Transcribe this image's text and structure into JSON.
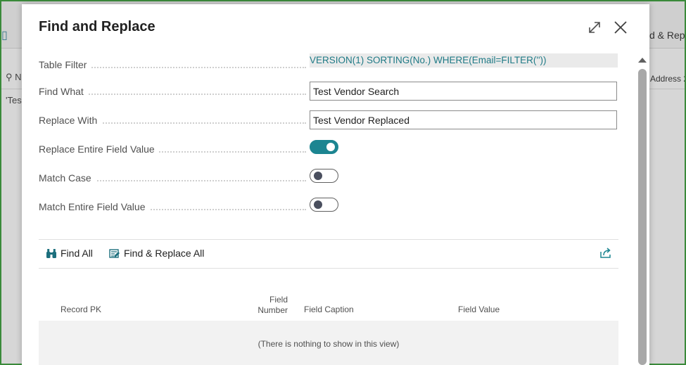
{
  "background": {
    "left_n": "N",
    "left_tes": "'Tes",
    "right_action": "d & Rep",
    "right_column": "Address 2"
  },
  "dialog": {
    "title": "Find and Replace",
    "fields": {
      "table_filter": {
        "label": "Table Filter",
        "value": "VERSION(1) SORTING(No.) WHERE(Email=FILTER(''))"
      },
      "find_what": {
        "label": "Find What",
        "value": "Test Vendor Search"
      },
      "replace_with": {
        "label": "Replace With",
        "value": "Test Vendor Replaced"
      },
      "replace_entire": {
        "label": "Replace Entire Field Value",
        "on": true
      },
      "match_case": {
        "label": "Match Case",
        "on": false
      },
      "match_entire": {
        "label": "Match Entire Field Value",
        "on": false
      }
    },
    "actions": {
      "find_all": "Find All",
      "find_replace_all": "Find & Replace All"
    },
    "table": {
      "columns": {
        "record_pk": "Record PK",
        "field_number_1": "Field",
        "field_number_2": "Number",
        "field_caption": "Field Caption",
        "field_value": "Field Value"
      },
      "empty_message": "(There is nothing to show in this view)"
    }
  },
  "colors": {
    "accent": "#1c8591",
    "filter_text": "#1f7a86"
  },
  "icons": [
    "expand-icon",
    "close-icon",
    "binoculars-icon",
    "find-replace-icon",
    "share-icon",
    "scroll-up-icon"
  ]
}
